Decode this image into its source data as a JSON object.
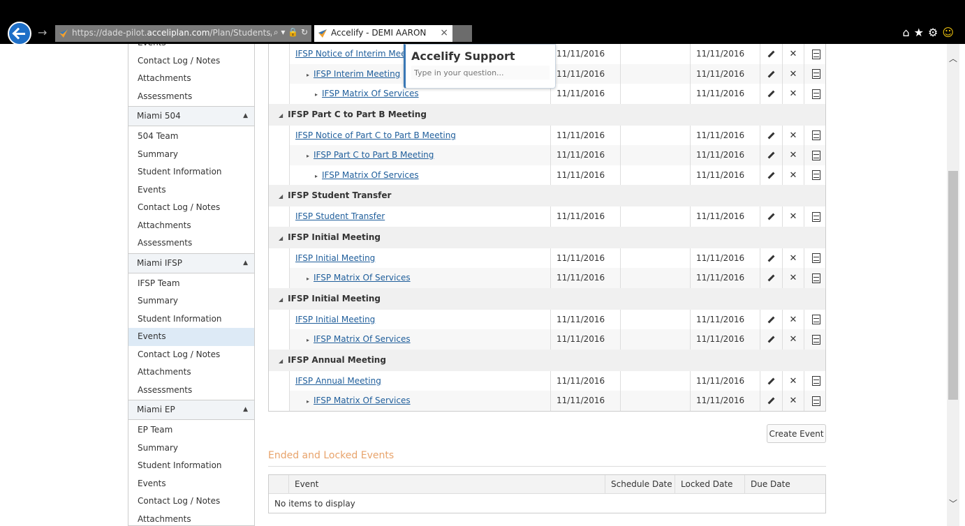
{
  "browser": {
    "url_prefix": "https://dade-pilot.",
    "url_domain": "acceliplan.com",
    "url_path": "/Plan/Students/V",
    "tab_title": "Accelify - DEMI AARON",
    "tab_close": "×"
  },
  "sidebar": {
    "top_partial": "Events",
    "items_a": [
      "Contact Log / Notes",
      "Attachments",
      "Assessments"
    ],
    "groups": [
      {
        "title": "Miami 504",
        "items": [
          "504 Team",
          "Summary",
          "Student Information",
          "Events",
          "Contact Log / Notes",
          "Attachments",
          "Assessments"
        ]
      },
      {
        "title": "Miami IFSP",
        "items": [
          "IFSP Team",
          "Summary",
          "Student Information",
          "Events",
          "Contact Log / Notes",
          "Attachments",
          "Assessments"
        ]
      },
      {
        "title": "Miami EP",
        "items": [
          "EP Team",
          "Summary",
          "Student Information",
          "Events",
          "Contact Log / Notes",
          "Attachments"
        ]
      }
    ]
  },
  "events": {
    "top_rows": [
      {
        "event": "IFSP Notice of Interim Meeting",
        "level": 0,
        "d1": "11/11/2016",
        "d2": "",
        "d3": "11/11/2016"
      },
      {
        "event": "IFSP Interim Meeting",
        "level": 1,
        "d1": "11/11/2016",
        "d2": "",
        "d3": "11/11/2016"
      },
      {
        "event": "IFSP Matrix Of Services",
        "level": 2,
        "d1": "11/11/2016",
        "d2": "",
        "d3": "11/11/2016"
      }
    ],
    "groups": [
      {
        "title": "IFSP Part C to Part B Meeting",
        "rows": [
          {
            "event": "IFSP Notice of Part C to Part B Meeting",
            "level": 0,
            "d1": "11/11/2016",
            "d2": "",
            "d3": "11/11/2016"
          },
          {
            "event": "IFSP Part C to Part B Meeting",
            "level": 1,
            "d1": "11/11/2016",
            "d2": "",
            "d3": "11/11/2016"
          },
          {
            "event": "IFSP Matrix Of Services",
            "level": 2,
            "d1": "11/11/2016",
            "d2": "",
            "d3": "11/11/2016"
          }
        ]
      },
      {
        "title": "IFSP Student Transfer",
        "rows": [
          {
            "event": "IFSP Student Transfer",
            "level": 0,
            "d1": "11/11/2016",
            "d2": "",
            "d3": "11/11/2016"
          }
        ]
      },
      {
        "title": "IFSP Initial Meeting",
        "rows": [
          {
            "event": "IFSP Initial Meeting",
            "level": 0,
            "d1": "11/11/2016",
            "d2": "",
            "d3": "11/11/2016"
          },
          {
            "event": "IFSP Matrix Of Services",
            "level": 1,
            "d1": "11/11/2016",
            "d2": "",
            "d3": "11/11/2016"
          }
        ]
      },
      {
        "title": "IFSP Initial Meeting",
        "rows": [
          {
            "event": "IFSP Initial Meeting",
            "level": 0,
            "d1": "11/11/2016",
            "d2": "",
            "d3": "11/11/2016"
          },
          {
            "event": "IFSP Matrix Of Services",
            "level": 1,
            "d1": "11/11/2016",
            "d2": "",
            "d3": "11/11/2016"
          }
        ]
      },
      {
        "title": "IFSP Annual Meeting",
        "rows": [
          {
            "event": "IFSP Annual Meeting",
            "level": 0,
            "d1": "11/11/2016",
            "d2": "",
            "d3": "11/11/2016"
          },
          {
            "event": "IFSP Matrix Of Services",
            "level": 1,
            "d1": "11/11/2016",
            "d2": "",
            "d3": "11/11/2016"
          }
        ]
      }
    ],
    "create_button": "Create Event"
  },
  "ended": {
    "title": "Ended and Locked Events",
    "columns": [
      "Event",
      "Schedule Date",
      "Locked Date",
      "Due Date"
    ],
    "empty_text": "No items to display"
  },
  "support": {
    "title": "Accelify Support",
    "placeholder": "Type in your question..."
  },
  "colors": {
    "link": "#1f5e9b",
    "accent_orange": "#e8a36b",
    "active_nav": "#ddeaf6"
  }
}
